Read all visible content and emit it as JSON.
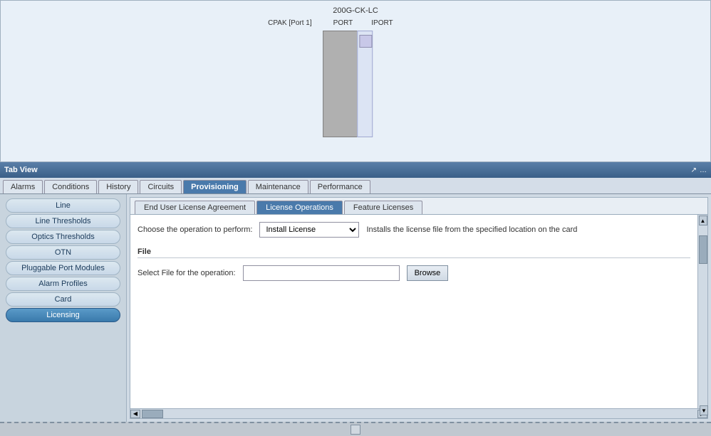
{
  "diagram": {
    "device_name": "200G-CK-LC",
    "port_labels": {
      "cpak": "CPAK [Port 1]",
      "port": "PORT",
      "iport": "IPORT"
    }
  },
  "tabview": {
    "title": "Tab View",
    "icons": [
      "↗",
      "…"
    ]
  },
  "main_tabs": [
    {
      "label": "Alarms",
      "active": false
    },
    {
      "label": "Conditions",
      "active": false
    },
    {
      "label": "History",
      "active": false
    },
    {
      "label": "Circuits",
      "active": false
    },
    {
      "label": "Provisioning",
      "active": true
    },
    {
      "label": "Maintenance",
      "active": false
    },
    {
      "label": "Performance",
      "active": false
    }
  ],
  "sidebar": {
    "items": [
      {
        "label": "Line",
        "active": false
      },
      {
        "label": "Line Thresholds",
        "active": false
      },
      {
        "label": "Optics Thresholds",
        "active": false
      },
      {
        "label": "OTN",
        "active": false
      },
      {
        "label": "Pluggable Port Modules",
        "active": false
      },
      {
        "label": "Alarm Profiles",
        "active": false
      },
      {
        "label": "Card",
        "active": false
      },
      {
        "label": "Licensing",
        "active": true
      }
    ]
  },
  "sub_tabs": [
    {
      "label": "End User License Agreement",
      "active": false
    },
    {
      "label": "License Operations",
      "active": true
    },
    {
      "label": "Feature Licenses",
      "active": false
    }
  ],
  "license_operations": {
    "operation_label": "Choose the operation to perform:",
    "operation_value": "Install License",
    "operation_note": "Installs the license file from the specified location on the card",
    "file_section": "File",
    "file_label": "Select File for the operation:",
    "file_placeholder": "",
    "browse_label": "Browse"
  },
  "bottom": {
    "resize_hint": "resize"
  }
}
